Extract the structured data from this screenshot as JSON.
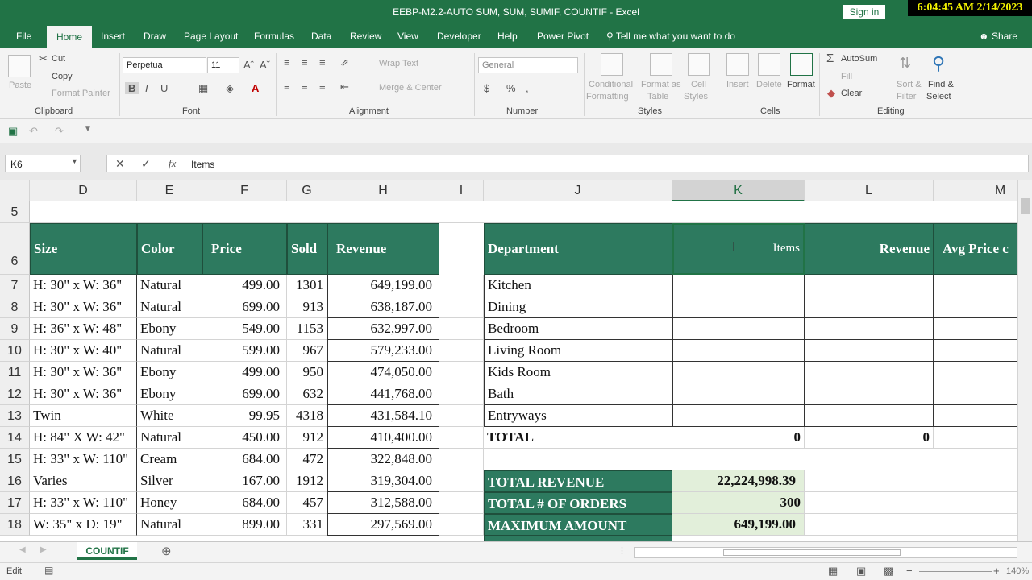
{
  "window": {
    "title": "EEBP-M2.2-AUTO SUM, SUM, SUMIF, COUNTIF  -  Excel",
    "signin": "Sign in",
    "clock": "6:04:45 AM 2/14/2023"
  },
  "menu": {
    "tabs": [
      "File",
      "Home",
      "Insert",
      "Draw",
      "Page Layout",
      "Formulas",
      "Data",
      "Review",
      "View",
      "Developer",
      "Help",
      "Power Pivot"
    ],
    "tell_me": "Tell me what you want to do",
    "share": "Share"
  },
  "ribbon": {
    "clipboard": {
      "paste": "Paste",
      "cut": "Cut",
      "copy": "Copy",
      "format_painter": "Format Painter",
      "label": "Clipboard"
    },
    "font": {
      "name": "Perpetua",
      "size": "11",
      "label": "Font"
    },
    "alignment": {
      "wrap_text": "Wrap Text",
      "merge_center": "Merge & Center",
      "label": "Alignment"
    },
    "number": {
      "format": "General",
      "label": "Number"
    },
    "styles": {
      "conditional": "Conditional",
      "formatting": "Formatting",
      "format_as": "Format as",
      "table": "Table",
      "cell": "Cell",
      "styles": "Styles",
      "label": "Styles"
    },
    "cells": {
      "insert": "Insert",
      "delete": "Delete",
      "format": "Format",
      "label": "Cells"
    },
    "editing": {
      "autosum": "AutoSum",
      "fill": "Fill",
      "clear": "Clear",
      "sort": "Sort &",
      "filter": "Filter",
      "find": "Find &",
      "select": "Select",
      "label": "Editing"
    }
  },
  "formula_bar": {
    "name_box": "K6",
    "content": "Items"
  },
  "columns": [
    "D",
    "E",
    "F",
    "G",
    "H",
    "I",
    "J",
    "K",
    "L",
    "M"
  ],
  "rows": [
    "5",
    "6",
    "7",
    "8",
    "9",
    "10",
    "11",
    "12",
    "13",
    "14",
    "15",
    "16",
    "17",
    "18"
  ],
  "left_table": {
    "headers": [
      "Size",
      "Color",
      "Price",
      "Sold",
      "Revenue"
    ],
    "rows": [
      [
        "H: 30\" x W: 36\"",
        "Natural",
        "499.00",
        "1301",
        "649,199.00"
      ],
      [
        "H: 30\" x W: 36\"",
        "Natural",
        "699.00",
        "913",
        "638,187.00"
      ],
      [
        "H: 36\" x W: 48\"",
        "Ebony",
        "549.00",
        "1153",
        "632,997.00"
      ],
      [
        "H: 30\" x W: 40\"",
        "Natural",
        "599.00",
        "967",
        "579,233.00"
      ],
      [
        "H: 30\" x W: 36\"",
        "Ebony",
        "499.00",
        "950",
        "474,050.00"
      ],
      [
        "H: 30\" x W: 36\"",
        "Ebony",
        "699.00",
        "632",
        "441,768.00"
      ],
      [
        "Twin",
        "White",
        "99.95",
        "4318",
        "431,584.10"
      ],
      [
        "H: 84\" X W: 42\"",
        "Natural",
        "450.00",
        "912",
        "410,400.00"
      ],
      [
        "H: 33\" x W: 110\"",
        "Cream",
        "684.00",
        "472",
        "322,848.00"
      ],
      [
        "Varies",
        "Silver",
        "167.00",
        "1912",
        "319,304.00"
      ],
      [
        "H: 33\" x W: 110\"",
        "Honey",
        "684.00",
        "457",
        "312,588.00"
      ],
      [
        "W: 35\" x D: 19\"",
        "Natural",
        "899.00",
        "331",
        "297,569.00"
      ]
    ]
  },
  "right_table": {
    "headers": [
      "Department",
      "Items",
      "Revenue",
      "Avg Price c"
    ],
    "departments": [
      "Kitchen",
      "Dining",
      "Bedroom",
      "Living Room",
      "Kids Room",
      "Bath",
      "Entryways"
    ],
    "total_label": "TOTAL",
    "total_items": "0",
    "total_revenue": "0"
  },
  "summary": [
    {
      "label": "TOTAL REVENUE",
      "value": "22,224,998.39"
    },
    {
      "label": "TOTAL # OF ORDERS",
      "value": "300"
    },
    {
      "label": "MAXIMUM AMOUNT",
      "value": "649,199.00"
    }
  ],
  "sheet": {
    "tab": "COUNTIF"
  },
  "status": {
    "mode": "Edit",
    "zoom": "140%"
  }
}
